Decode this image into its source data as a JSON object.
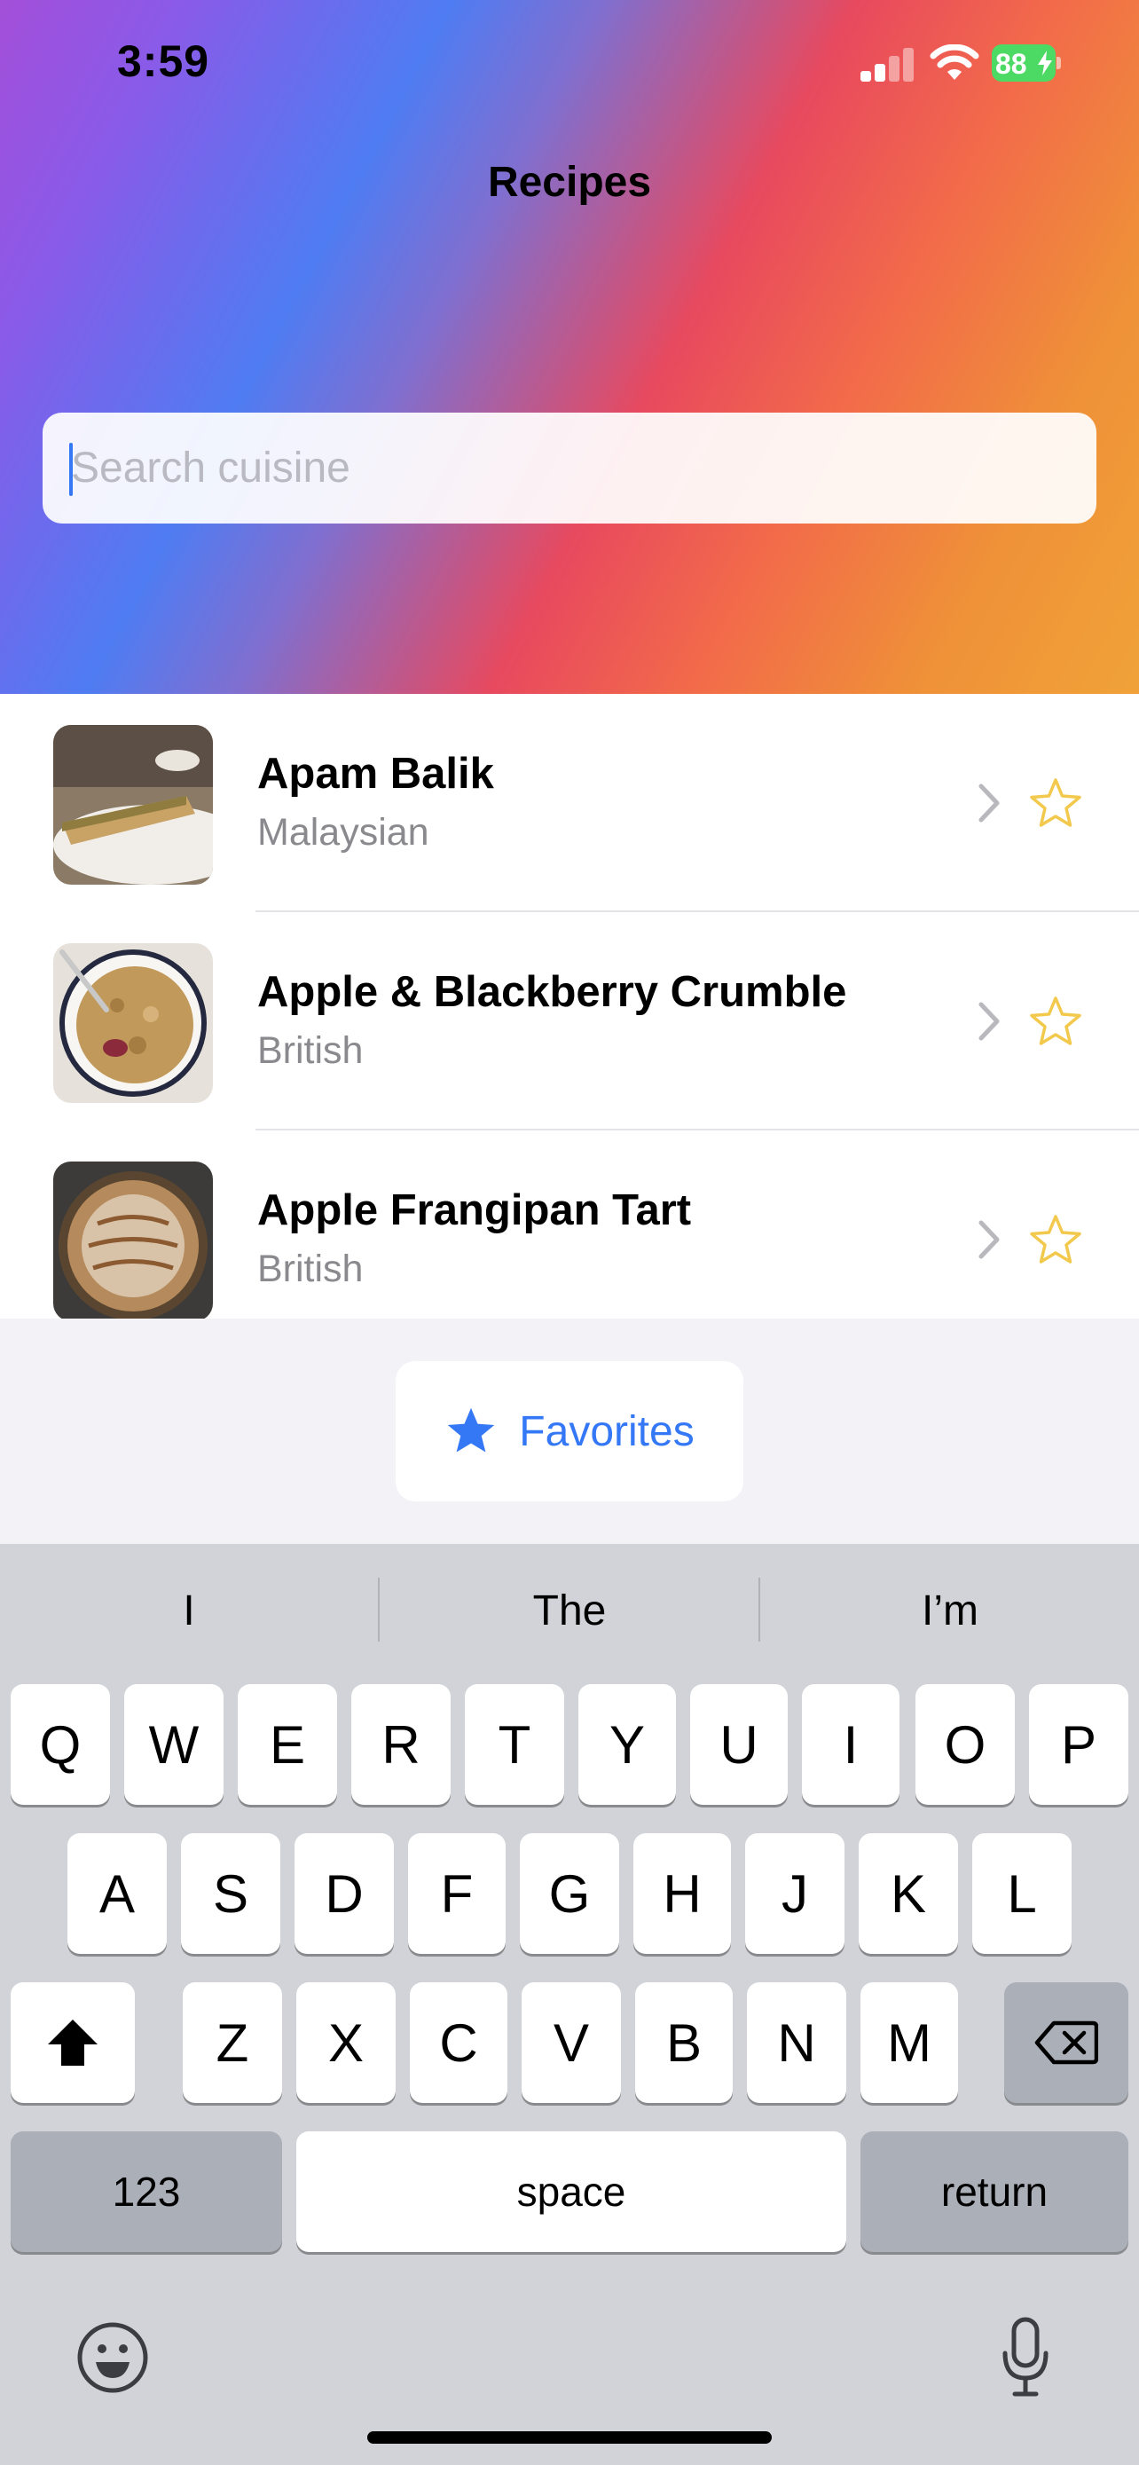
{
  "status_bar": {
    "time": "3:59",
    "battery": "88"
  },
  "nav": {
    "title": "Recipes"
  },
  "search": {
    "placeholder": "Search cuisine",
    "value": ""
  },
  "recipes": [
    {
      "name": "Apam Balik",
      "area": "Malaysian"
    },
    {
      "name": "Apple & Blackberry Crumble",
      "area": "British"
    },
    {
      "name": "Apple Frangipan Tart",
      "area": "British"
    }
  ],
  "favorites": {
    "label": "Favorites"
  },
  "keyboard": {
    "suggestions": [
      "I",
      "The",
      "I’m"
    ],
    "row1": [
      "Q",
      "W",
      "E",
      "R",
      "T",
      "Y",
      "U",
      "I",
      "O",
      "P"
    ],
    "row2": [
      "A",
      "S",
      "D",
      "F",
      "G",
      "H",
      "J",
      "K",
      "L"
    ],
    "row3": [
      "Z",
      "X",
      "C",
      "V",
      "B",
      "N",
      "M"
    ],
    "numbers_label": "123",
    "space_label": "space",
    "return_label": "return"
  },
  "colors": {
    "accent": "#3478f6",
    "star": "#f2c94c",
    "battery": "#4cd964"
  }
}
